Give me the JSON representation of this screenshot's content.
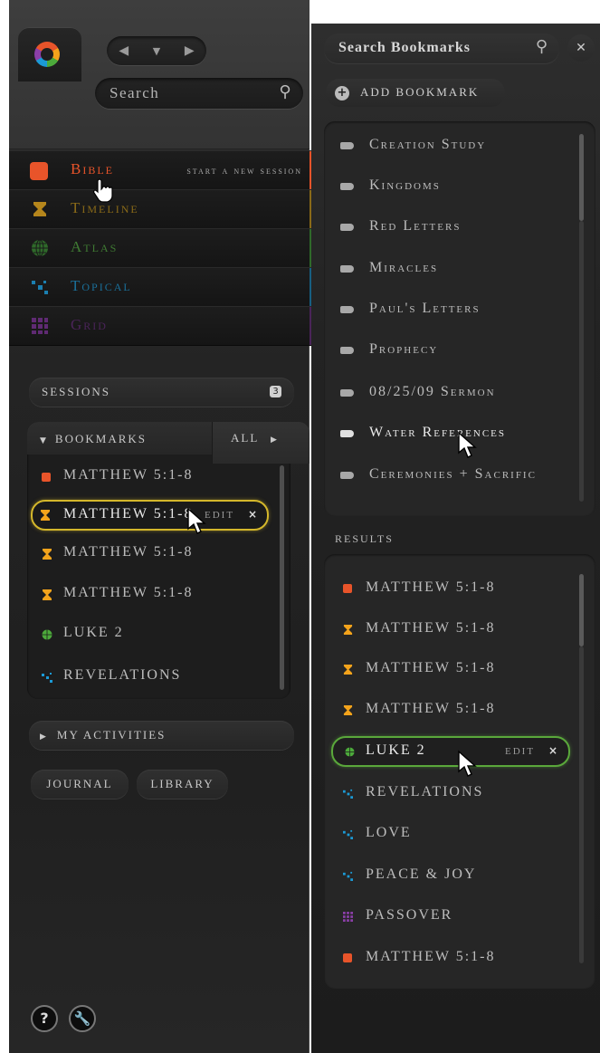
{
  "left": {
    "search_placeholder": "Search",
    "modules": [
      {
        "label": "Bible",
        "aside": "start a new session",
        "color": "#e8542a",
        "icon": "bible-square-icon"
      },
      {
        "label": "Timeline",
        "color": "#d99a1f",
        "icon": "hourglass-icon"
      },
      {
        "label": "Atlas",
        "color": "#4c9a3b",
        "icon": "globe-icon"
      },
      {
        "label": "Topical",
        "color": "#1b9ad6",
        "icon": "topical-dots-icon"
      },
      {
        "label": "Grid",
        "color": "#8b3fa8",
        "icon": "grid-icon"
      }
    ],
    "sessions_label": "SESSIONS",
    "sessions_count": "3",
    "bookmarks_label": "BOOKMARKS",
    "all_label": "ALL",
    "bookmarks": [
      {
        "label": "MATTHEW 5:1-8",
        "icon": "bible-square-icon"
      },
      {
        "label": "MATTHEW 5:1-8",
        "icon": "hourglass-icon",
        "edit": "EDIT"
      },
      {
        "label": "MATTHEW 5:1-8",
        "icon": "hourglass-icon"
      },
      {
        "label": "MATTHEW 5:1-8",
        "icon": "hourglass-icon"
      },
      {
        "label": "LUKE 2",
        "icon": "globe-icon"
      },
      {
        "label": "REVELATIONS",
        "icon": "topical-dots-icon"
      }
    ],
    "my_activities": "MY ACTIVITIES",
    "journal": "JOURNAL",
    "library": "LIBRARY"
  },
  "right": {
    "search_placeholder": "Search Bookmarks",
    "add_bookmark": "ADD BOOKMARK",
    "bookmark_list": [
      "Creation Study",
      "Kingdoms",
      "Red Letters",
      "Miracles",
      "Paul's Letters",
      "Prophecy",
      "08/25/09 Sermon",
      "Water References",
      "Ceremonies + Sacrific"
    ],
    "results_label": "RESULTS",
    "results": [
      {
        "label": "MATTHEW 5:1-8",
        "icon": "bible-square-icon"
      },
      {
        "label": "MATTHEW 5:1-8",
        "icon": "hourglass-icon"
      },
      {
        "label": "MATTHEW 5:1-8",
        "icon": "hourglass-icon"
      },
      {
        "label": "MATTHEW 5:1-8",
        "icon": "hourglass-icon"
      },
      {
        "label": "LUKE 2",
        "icon": "globe-icon",
        "edit": "EDIT"
      },
      {
        "label": "REVELATIONS",
        "icon": "topical-dots-icon"
      },
      {
        "label": "LOVE",
        "icon": "topical-dots-icon"
      },
      {
        "label": "PEACE & JOY",
        "icon": "topical-dots-icon"
      },
      {
        "label": "PASSOVER",
        "icon": "grid-icon"
      },
      {
        "label": "MATTHEW 5:1-8",
        "icon": "bible-square-icon"
      }
    ]
  },
  "colors": {
    "bible": "#e8542a",
    "timeline": "#f3a31b",
    "atlas": "#4caa3b",
    "topical": "#1b9ad6",
    "grid": "#8b3fa8",
    "highlight_yellow": "#d4b72b",
    "highlight_green": "#5aa83b"
  }
}
